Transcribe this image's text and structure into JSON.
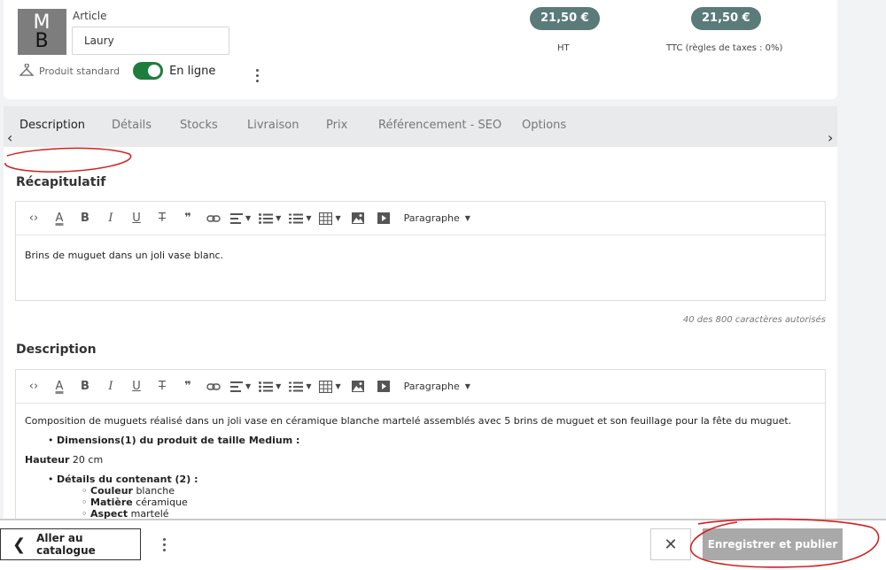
{
  "header": {
    "logo_letters": [
      "M",
      "B"
    ],
    "article_label": "Article",
    "article_value": "Laury",
    "type_label": "Produit standard",
    "online_label": "En ligne",
    "online_enabled": true,
    "price_ht": "21,50 €",
    "price_ht_caption": "HT",
    "price_ttc": "21,50 €",
    "price_ttc_caption": "TTC (règles de taxes : 0%)"
  },
  "tabs": [
    {
      "label": "Description",
      "active": true
    },
    {
      "label": "Détails",
      "active": false
    },
    {
      "label": "Stocks",
      "active": false
    },
    {
      "label": "Livraison",
      "active": false
    },
    {
      "label": "Prix",
      "active": false
    },
    {
      "label": "Référencement - SEO",
      "active": false
    },
    {
      "label": "Options",
      "active": false
    }
  ],
  "tabs_nav": {
    "prev": "‹",
    "next": "›"
  },
  "recap": {
    "title": "Récapitulatif",
    "format_label": "Paragraphe",
    "text": "Brins de muguet dans un joli vase blanc.",
    "counter": "40 des 800 caractères autorisés"
  },
  "description": {
    "title": "Description",
    "format_label": "Paragraphe",
    "intro": "Composition de muguets réalisé dans un joli vase en céramique blanche martelé assemblés avec 5 brins de muguet et son feuillage pour la fête du muguet.",
    "dimensions_heading": "Dimensions(1) du produit de taille Medium :",
    "height_label": "Hauteur",
    "height_value": " 20 cm",
    "container_heading": "Détails du contenant (2) :",
    "details": [
      {
        "label": "Couleur",
        "value": " blanche"
      },
      {
        "label": "Matière",
        "value": " céramique"
      },
      {
        "label": "Aspect",
        "value": " martelé"
      }
    ]
  },
  "footer": {
    "catalog_label": "Aller au catalogue",
    "publish_label": "Enregistrer et publier",
    "close_symbol": "✕"
  },
  "colors": {
    "price_badge": "#5b7a7a",
    "toggle_on": "#1e7d3c",
    "annotation": "#d41f1f",
    "publish_disabled": "#a9a9a9"
  }
}
